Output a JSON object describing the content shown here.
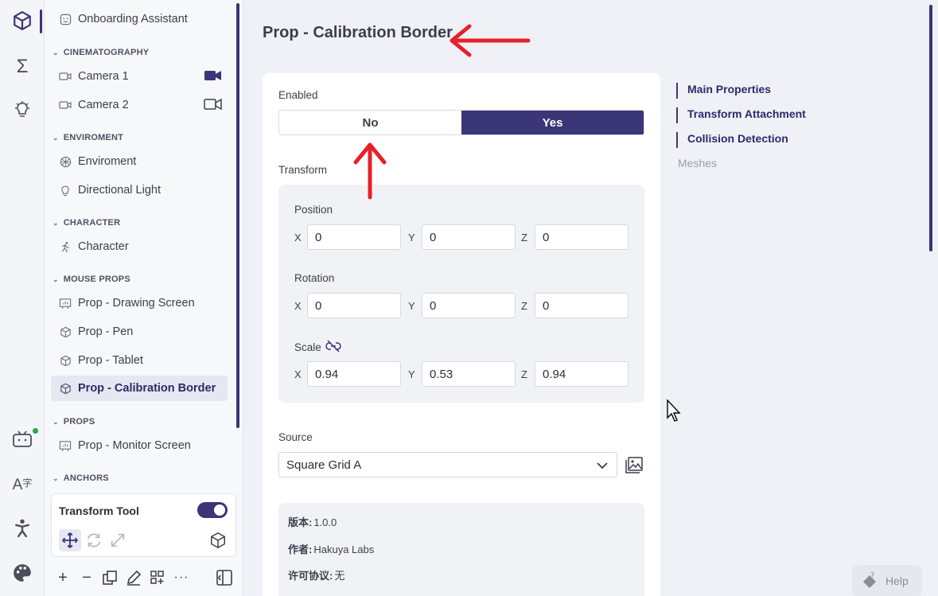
{
  "sidebar": {
    "top_item": "Onboarding Assistant",
    "groups": {
      "cinematography": {
        "label": "CINEMATOGRAPHY",
        "items": [
          "Camera 1",
          "Camera 2"
        ]
      },
      "environment": {
        "label": "ENVIROMENT",
        "items": [
          "Enviroment",
          "Directional Light"
        ]
      },
      "character": {
        "label": "CHARACTER",
        "items": [
          "Character"
        ]
      },
      "mouse_props": {
        "label": "MOUSE PROPS",
        "items": [
          "Prop - Drawing Screen",
          "Prop - Pen",
          "Prop - Tablet",
          "Prop - Calibration Border"
        ]
      },
      "props": {
        "label": "PROPS",
        "items": [
          "Prop - Monitor Screen"
        ]
      },
      "anchors": {
        "label": "ANCHORS"
      }
    },
    "selected": "Prop - Calibration Border",
    "tool": {
      "title": "Transform Tool",
      "enabled": true
    }
  },
  "main": {
    "title": "Prop - Calibration Border",
    "enabled": {
      "label": "Enabled",
      "no": "No",
      "yes": "Yes",
      "value": "Yes"
    },
    "transform": {
      "label": "Transform",
      "position": {
        "label": "Position",
        "x": "0",
        "y": "0",
        "z": "0"
      },
      "rotation": {
        "label": "Rotation",
        "x": "0",
        "y": "0",
        "z": "0"
      },
      "scale": {
        "label": "Scale",
        "x": "0.94",
        "y": "0.53",
        "z": "0.94"
      },
      "axes": {
        "x": "X",
        "y": "Y",
        "z": "Z"
      }
    },
    "source": {
      "label": "Source",
      "value": "Square Grid A"
    },
    "info": {
      "version_label": "版本:",
      "version": "1.0.0",
      "author_label": "作者:",
      "author": "Hakuya Labs",
      "license_label": "许可协议:",
      "license": "无"
    }
  },
  "toc": [
    "Main Properties",
    "Transform Attachment",
    "Collision Detection",
    "Meshes"
  ],
  "help": {
    "label": "Help"
  },
  "colors": {
    "accent": "#3a3677",
    "annotation": "#e8202a"
  }
}
